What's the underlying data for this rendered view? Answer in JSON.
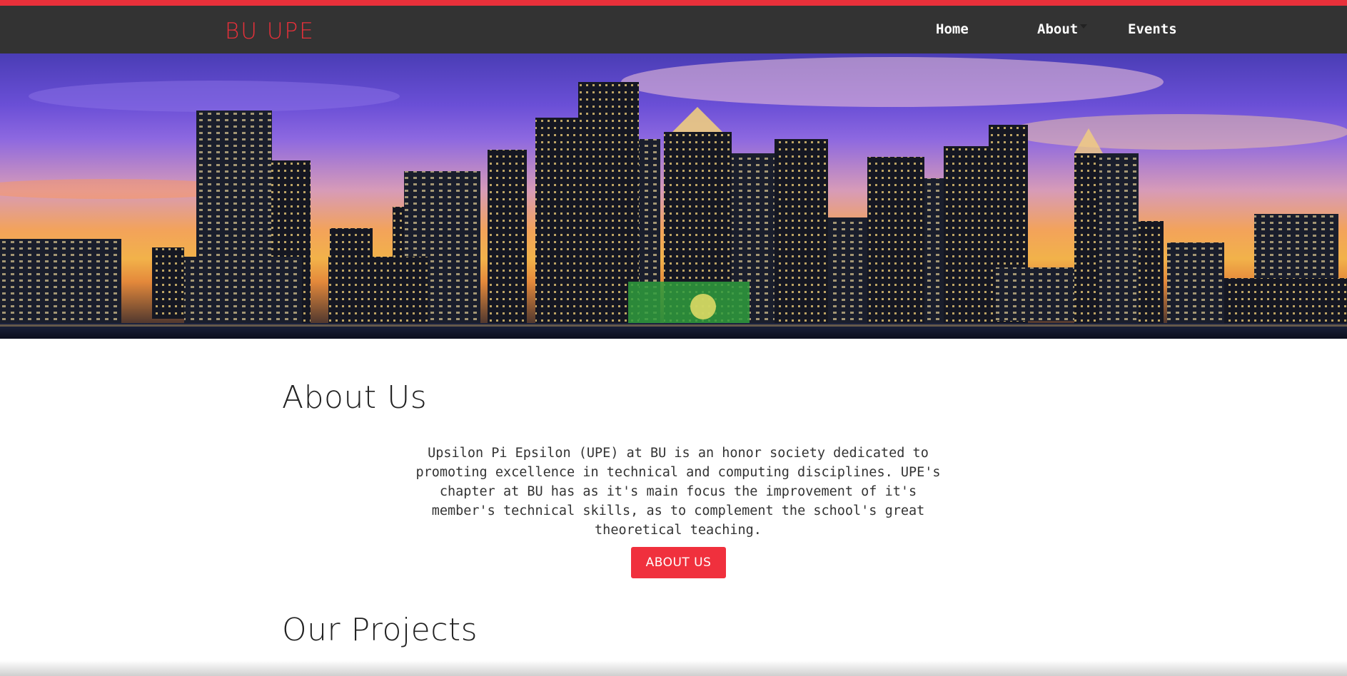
{
  "header": {
    "brand": "BU UPE",
    "nav": {
      "home": "Home",
      "about": "About",
      "events": "Events"
    },
    "colors": {
      "accent": "#e8303a",
      "bar": "#333333"
    }
  },
  "hero": {
    "image_alt": "Boston skyline at sunset"
  },
  "about": {
    "title": "About Us",
    "text": "Upsilon Pi Epsilon (UPE) at BU is an honor society dedicated to promoting excellence in technical and computing disciplines. UPE's chapter at BU has as it's main focus the improvement of it's member's technical skills, as to complement the school's great theoretical teaching.",
    "button_label": "ABOUT US"
  },
  "projects": {
    "title": "Our Projects"
  }
}
